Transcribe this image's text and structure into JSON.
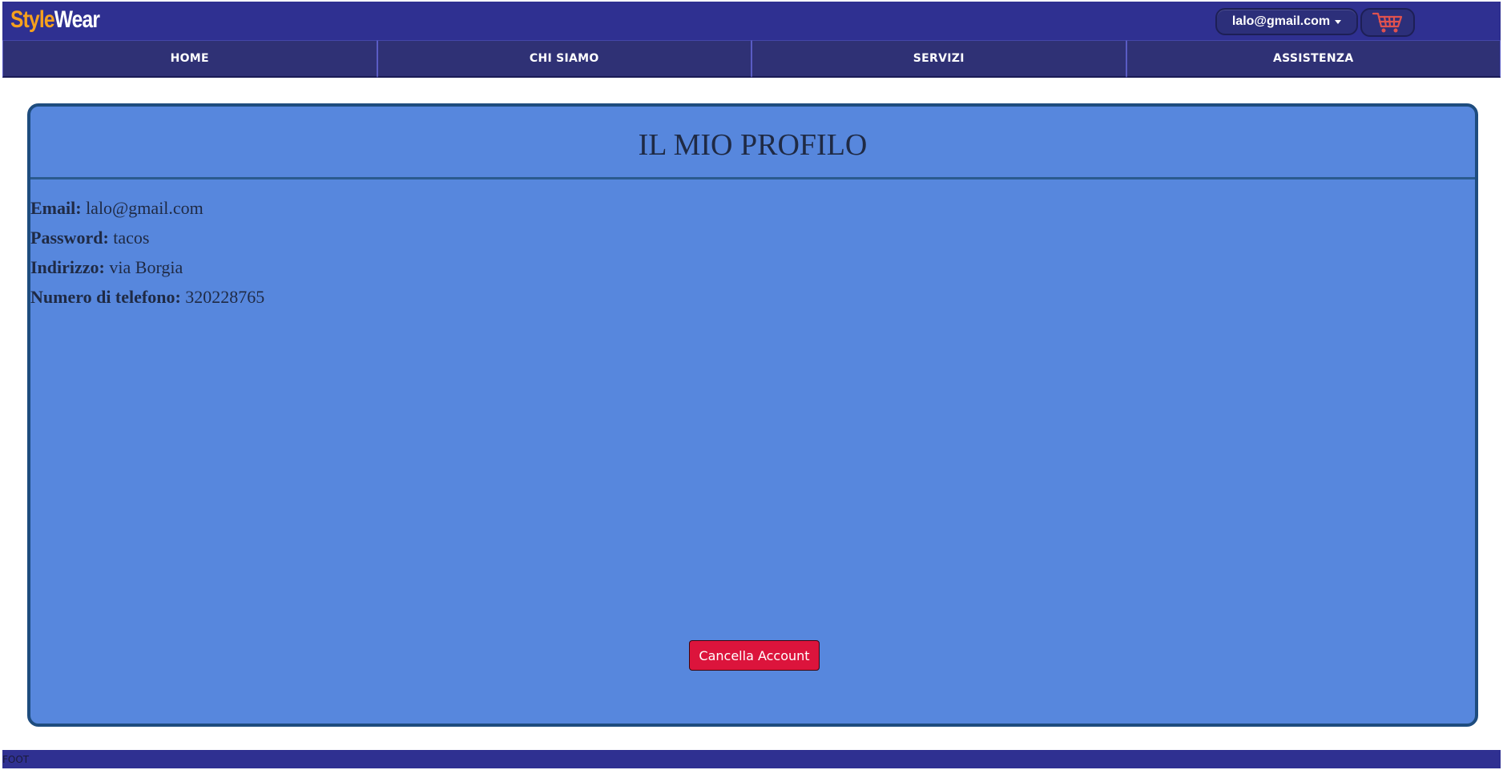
{
  "header": {
    "logo_part1": "Style",
    "logo_part2": "Wear",
    "user_label": "lalo@gmail.com",
    "cart_icon": "shopping-cart-icon"
  },
  "nav": {
    "items": [
      {
        "label": "HOME"
      },
      {
        "label": "CHI SIAMO"
      },
      {
        "label": "SERVIZI"
      },
      {
        "label": "ASSISTENZA"
      }
    ]
  },
  "profile": {
    "title": "IL MIO PROFILO",
    "fields": [
      {
        "label": "Email:",
        "value": "lalo@gmail.com"
      },
      {
        "label": "Password:",
        "value": "tacos"
      },
      {
        "label": "Indirizzo:",
        "value": "via Borgia"
      },
      {
        "label": "Numero di telefono:",
        "value": "320228765"
      }
    ],
    "delete_button": "Cancella Account"
  },
  "footer": {
    "text": "FOOT"
  },
  "colors": {
    "header_bg": "#2f3091",
    "logo_accent": "#f6a11d",
    "panel_bg": "#5787dd",
    "panel_border": "#1e4c7e",
    "danger": "#dc143c"
  }
}
